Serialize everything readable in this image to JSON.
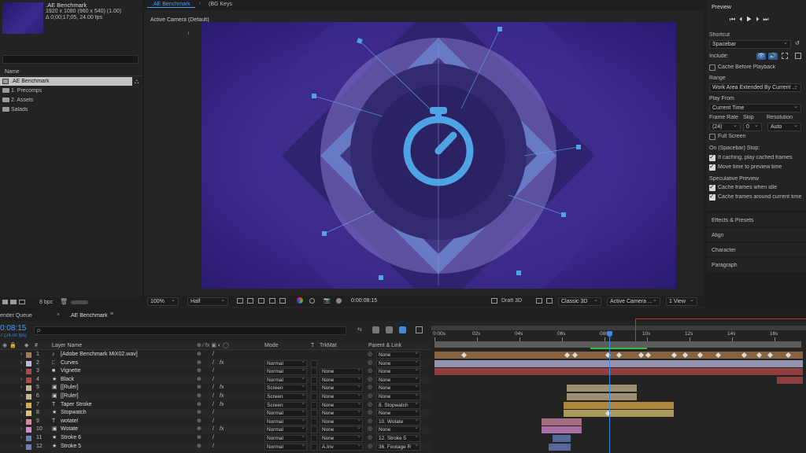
{
  "project": {
    "comp_name": ".AE Benchmark",
    "comp_res": "1920 x 1080  (960 x 540) (1.00)",
    "comp_dur": "Δ 0;00;17;05, 24.00 fps",
    "column_header": "Name",
    "items": [
      {
        "name": ".AE Benchmark",
        "type": "comp",
        "selected": true
      },
      {
        "name": "1. Precomps",
        "type": "folder"
      },
      {
        "name": "2. Assets",
        "type": "folder"
      },
      {
        "name": "Salads",
        "type": "folder"
      }
    ],
    "bpc": "8 bpc"
  },
  "viewer": {
    "tabs": [
      ".AE Benchmark",
      "(BG Keys"
    ],
    "camera_label": "Active Camera (Default)",
    "zoom": "100%",
    "resolution": "Half",
    "timecode": "0:00:08:15",
    "renderer": "Draft 3D",
    "renderer_mode": "Classic 3D",
    "camera_view": "Active Camera ...",
    "views": "1 View"
  },
  "preview": {
    "title": "Preview",
    "shortcut_label": "Shortcut",
    "shortcut": "Spacebar",
    "include_label": "Include:",
    "cache_before_playback": "Cache Before Playback",
    "range_label": "Range",
    "range": "Work Area Extended By Current ...",
    "play_from_label": "Play From",
    "play_from": "Current Time",
    "frame_rate_label": "Frame Rate",
    "skip_label": "Skip",
    "resolution_label": "Resolution",
    "frame_rate": "(24)",
    "skip": "0",
    "resolution": "Auto",
    "full_screen": "Full Screen",
    "stop_label": "On (Spacebar) Stop:",
    "if_caching": "If caching, play cached frames",
    "move_time": "Move time to preview time",
    "speculative_label": "Speculative Preview",
    "cache_idle": "Cache frames when idle",
    "cache_around": "Cache frames around current time"
  },
  "side_panels": [
    "Effects & Presets",
    "Align",
    "Character",
    "Paragraph"
  ],
  "timeline": {
    "render_queue_tab": "ender Queue",
    "comp_tab": ".AE Benchmark",
    "timecode": "0:08:15",
    "fps": "7 (24.00 fps)",
    "search_placeholder": "ρ·",
    "columns": {
      "num": "#",
      "layer_name": "Layer Name",
      "mode": "Mode",
      "t": "T",
      "trkmat": "TrkMat",
      "parent": "Parent & Link"
    },
    "ruler": [
      "0:00s",
      "02s",
      "04s",
      "06s",
      "08s",
      "10s",
      "12s",
      "14s",
      "16s"
    ],
    "current_time_frac": 0.475,
    "layers": [
      {
        "num": "1",
        "color": "#a97a4e",
        "type": "audio",
        "name": "[Adobe Benchmark MiX02.wav]",
        "mode": "",
        "trkmat": "",
        "parent": "None",
        "fx": false
      },
      {
        "num": "2",
        "color": "#b9b9e0",
        "type": "adjust",
        "name": "Curves",
        "mode": "Normal",
        "trkmat": "",
        "parent": "None",
        "fx": true
      },
      {
        "num": "3",
        "color": "#b34848",
        "type": "solid",
        "name": "Vignette",
        "mode": "Normal",
        "trkmat": "None",
        "parent": "None",
        "fx": false
      },
      {
        "num": "4",
        "color": "#b34848",
        "type": "shape",
        "name": "Black",
        "mode": "Normal",
        "trkmat": "None",
        "parent": "None",
        "fx": false
      },
      {
        "num": "5",
        "color": "#c8b48c",
        "type": "comp",
        "name": "[[Ruler]",
        "mode": "Screen",
        "trkmat": "None",
        "parent": "None",
        "fx": true
      },
      {
        "num": "6",
        "color": "#c8b48c",
        "type": "comp",
        "name": "[[Ruler]",
        "mode": "Screen",
        "trkmat": "None",
        "parent": "None",
        "fx": true
      },
      {
        "num": "7",
        "color": "#d9a94a",
        "type": "text",
        "name": "Taper Stroke",
        "mode": "Screen",
        "trkmat": "None",
        "parent": "8. Stopwatch",
        "fx": true
      },
      {
        "num": "8",
        "color": "#d9c46a",
        "type": "shape",
        "name": "Stopwatch",
        "mode": "Normal",
        "trkmat": "None",
        "parent": "None",
        "fx": false
      },
      {
        "num": "9",
        "color": "#d38aa0",
        "type": "text",
        "name": "wotate!",
        "mode": "Normal",
        "trkmat": "None",
        "parent": "10. Wotate",
        "fx": false
      },
      {
        "num": "10",
        "color": "#d38ad0",
        "type": "comp",
        "name": "Wotate",
        "mode": "Normal",
        "trkmat": "None",
        "parent": "None",
        "fx": true
      },
      {
        "num": "11",
        "color": "#6a7fc0",
        "type": "shape",
        "name": "Stroke 6",
        "mode": "Normal",
        "trkmat": "None",
        "parent": "12. Stroke 5",
        "fx": false
      },
      {
        "num": "12",
        "color": "#6a7fc0",
        "type": "shape",
        "name": "Stroke 5",
        "mode": "Normal",
        "trkmat": "A.Inv",
        "parent": "36. Footage R",
        "fx": false
      }
    ]
  }
}
